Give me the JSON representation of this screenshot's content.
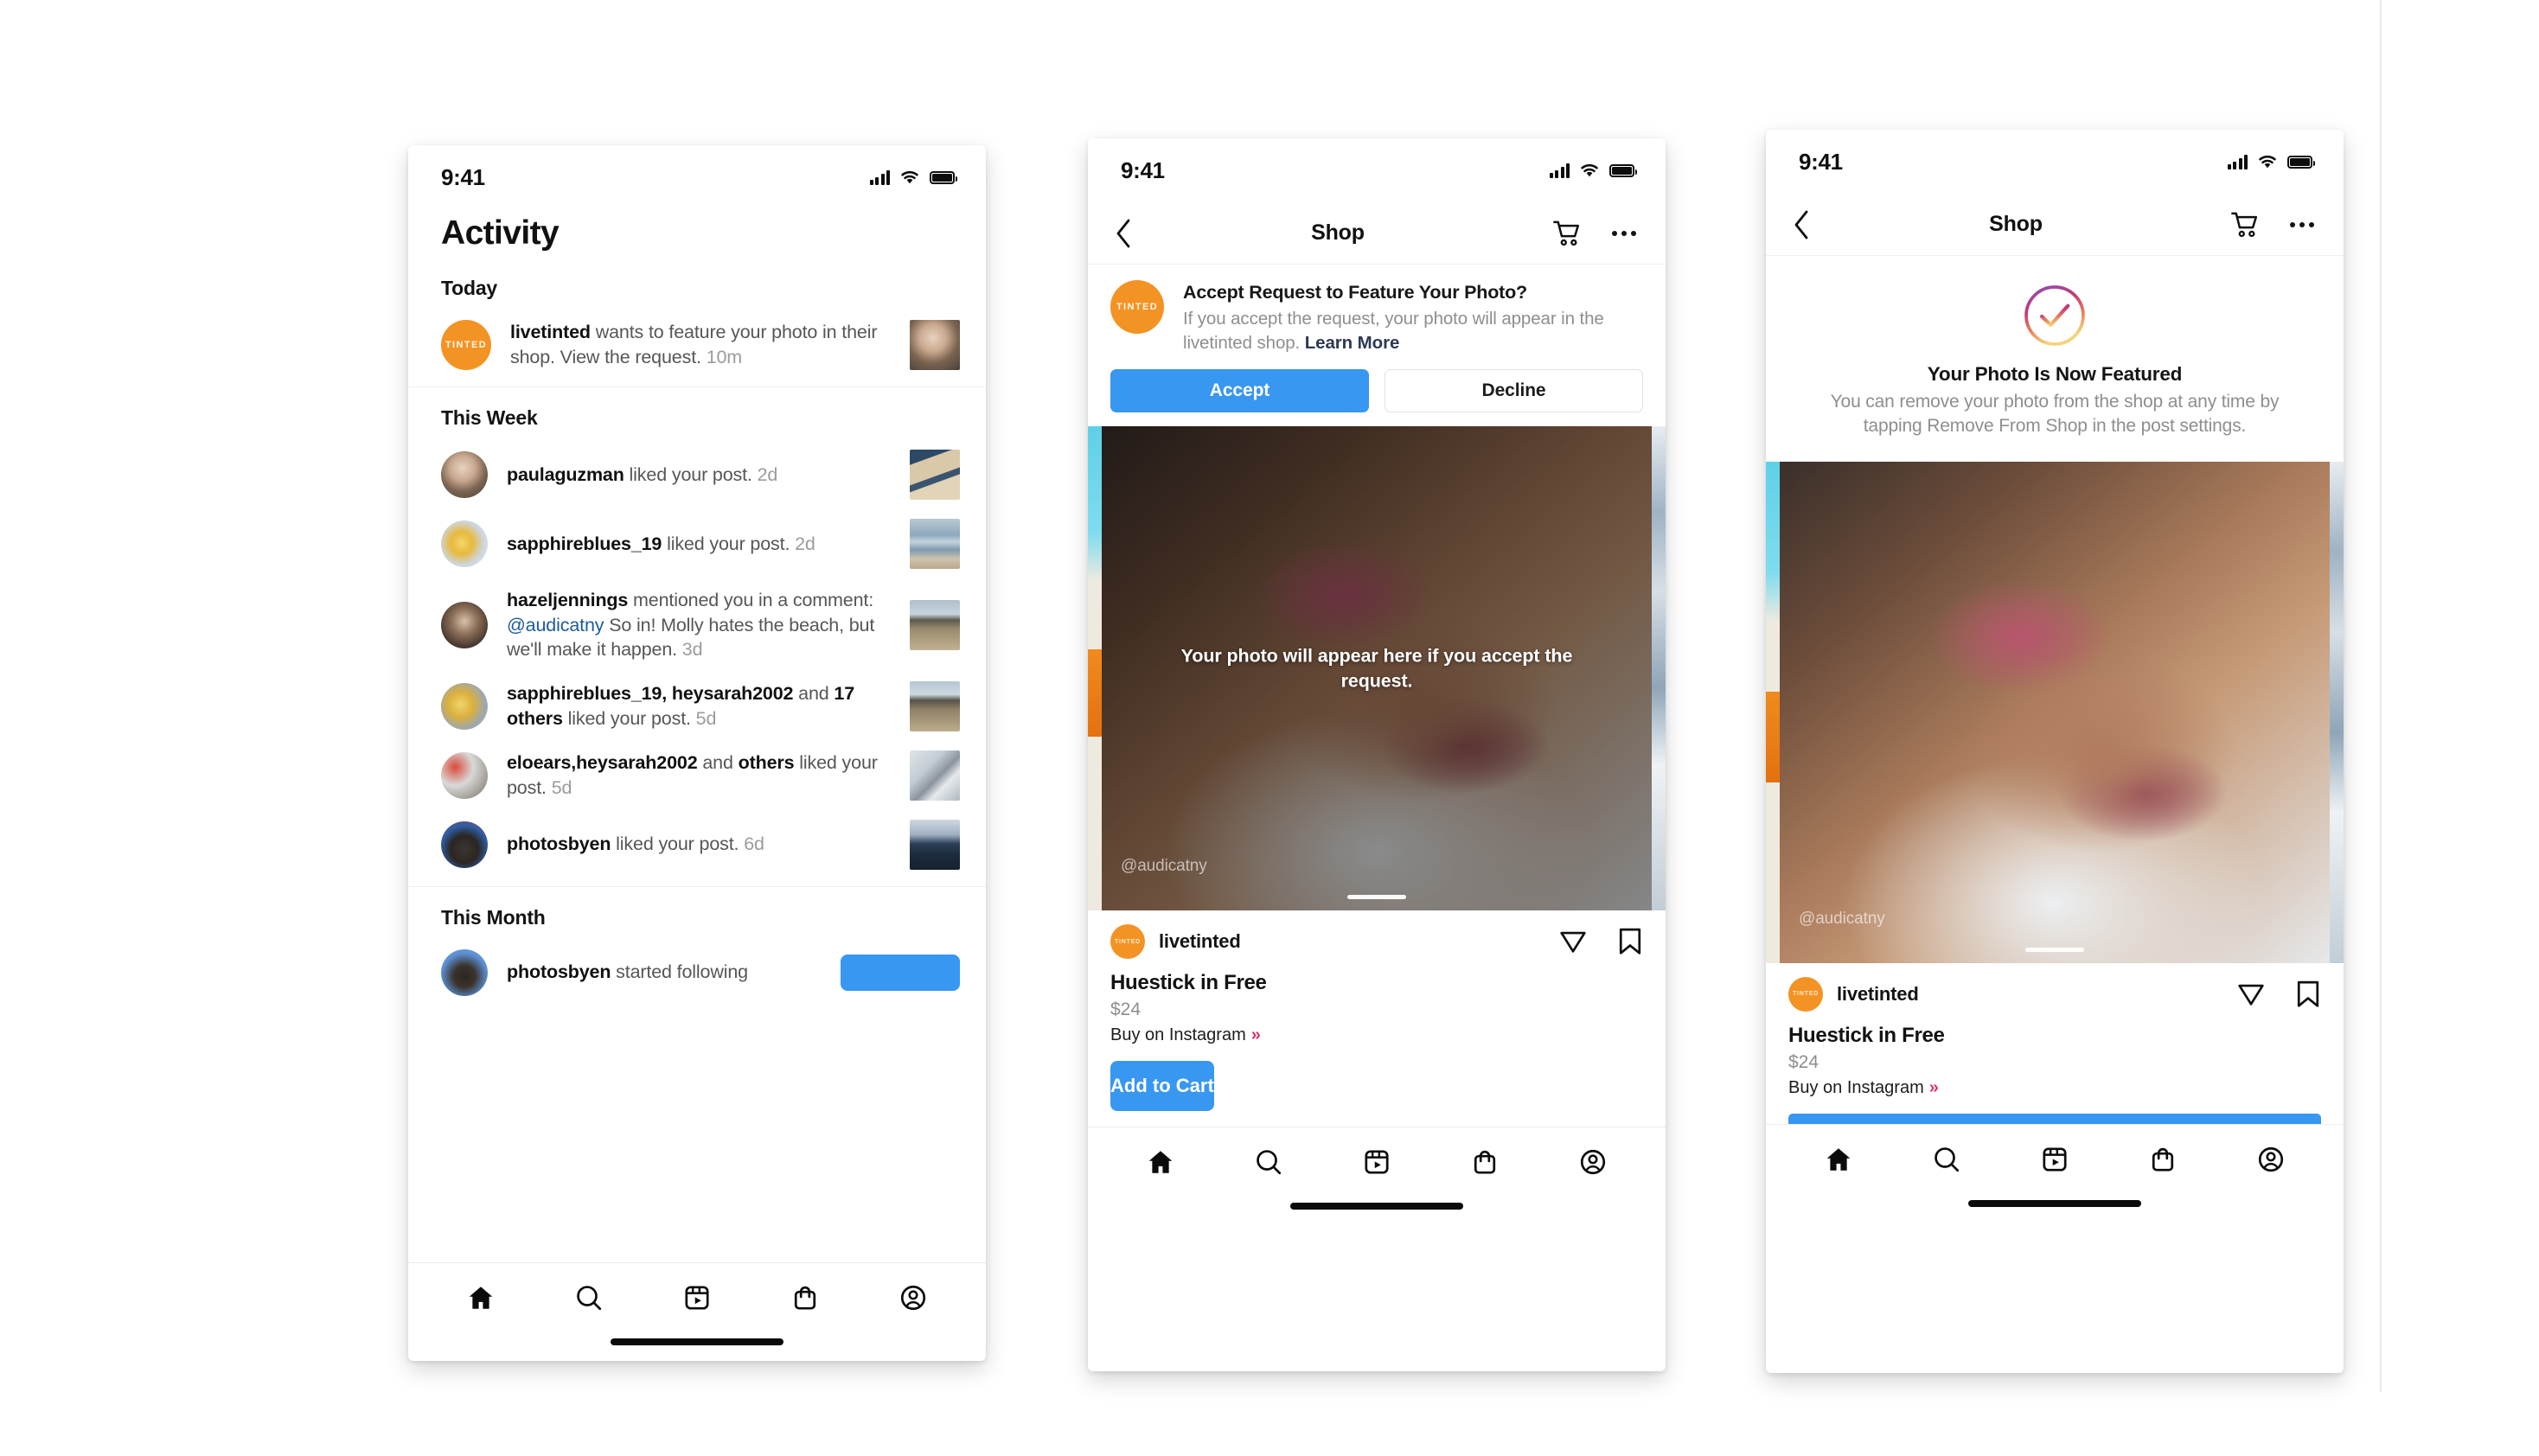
{
  "status_bar": {
    "time": "9:41",
    "signal_icon": "cellular-bars-icon",
    "wifi_icon": "wifi-icon",
    "battery_icon": "battery-icon"
  },
  "phone1": {
    "title": "Activity",
    "sections": [
      {
        "label": "Today"
      },
      {
        "label": "This Week"
      },
      {
        "label": "This Month"
      }
    ],
    "today": [
      {
        "avatar": "tinted-logo-avatar",
        "avatar_text": "TINTED",
        "user": "livetinted",
        "body": " wants to feature your photo in their shop. View the request. ",
        "time": "10m",
        "thumb": "portrait-thumb"
      }
    ],
    "this_week": [
      {
        "avatar": "paulaguzman-avatar",
        "user": "paulaguzman",
        "body": " liked your post. ",
        "time": "2d",
        "thumb": "beach-aerial-thumb"
      },
      {
        "avatar": "sapphireblues-avatar",
        "user": "sapphireblues_19",
        "body": " liked your post. ",
        "time": "2d",
        "thumb": "ocean-thumb"
      },
      {
        "avatar": "hazeljennings-avatar",
        "user": "hazeljennings",
        "body": " mentioned you in a comment: ",
        "mention": "@audicatny",
        "body2": " So in! Molly hates the beach, but we'll make it happen. ",
        "time": "3d",
        "thumb": "sand-dune-thumb"
      },
      {
        "avatar": "sapphireblues-avatar-2",
        "user": "sapphireblues_19, heysarah2002",
        "mid": " and ",
        "user2": "17 others",
        "body": " liked your post. ",
        "time": "5d",
        "thumb": "sand-dune-thumb-2"
      },
      {
        "avatar": "eloears-avatar",
        "user": "eloears,heysarah2002",
        "mid": " and ",
        "user2": "others",
        "body": " liked your post. ",
        "time": "5d",
        "thumb": "coffee-thumb"
      },
      {
        "avatar": "photosbyen-avatar",
        "user": "photosbyen",
        "body": " liked your post. ",
        "time": "6d",
        "thumb": "forest-thumb"
      }
    ],
    "this_month": [
      {
        "avatar": "photosbyen-avatar-2",
        "user": "photosbyen",
        "body": " started following",
        "follow_button": "follow-button"
      }
    ]
  },
  "phone2": {
    "header": {
      "back_icon": "chevron-left-icon",
      "title": "Shop",
      "cart_icon": "shopping-cart-icon",
      "more_icon": "more-options-icon"
    },
    "request": {
      "avatar_text": "TINTED",
      "title": "Accept Request to Feature Your Photo?",
      "subtitle": "If you accept the request, your photo will appear in the livetinted shop. ",
      "learn_more": "Learn More",
      "accept_label": "Accept",
      "decline_label": "Decline"
    },
    "carousel": {
      "caption": "Your photo will appear here if you accept the request.",
      "watermark": "@audicatny"
    },
    "product": {
      "username": "livetinted",
      "avatar_text": "TINTED",
      "name": "Huestick in Free",
      "price": "$24",
      "buy_label": "Buy on Instagram",
      "buy_chevron": "double-chevron-right-icon",
      "share_icon": "share-paperplane-icon",
      "save_icon": "bookmark-icon",
      "cta_label": "Add to Cart"
    }
  },
  "phone3": {
    "header": {
      "back_icon": "chevron-left-icon",
      "title": "Shop",
      "cart_icon": "shopping-cart-icon",
      "more_icon": "more-options-icon"
    },
    "success": {
      "check_icon": "gradient-check-circle-icon",
      "title": "Your Photo Is Now Featured",
      "subtitle": "You can remove your photo from the shop at any time by tapping Remove From Shop in the post settings."
    },
    "carousel": {
      "watermark": "@audicatny"
    },
    "product": {
      "username": "livetinted",
      "avatar_text": "TINTED",
      "name": "Huestick in Free",
      "price": "$24",
      "buy_label": "Buy on Instagram",
      "share_icon": "share-paperplane-icon",
      "save_icon": "bookmark-icon"
    }
  },
  "bottom_nav": {
    "items": [
      {
        "icon": "home-icon",
        "name": "nav-home"
      },
      {
        "icon": "search-icon",
        "name": "nav-search"
      },
      {
        "icon": "reels-icon",
        "name": "nav-reels"
      },
      {
        "icon": "shop-bag-icon",
        "name": "nav-shop"
      },
      {
        "icon": "profile-icon",
        "name": "nav-profile"
      }
    ]
  },
  "colors": {
    "accent_blue": "#3897F0",
    "brand_orange": "#F39324",
    "mention_blue": "#1C5B9C",
    "muted_gray": "#8E8E8E",
    "pink": "#E1306C"
  }
}
